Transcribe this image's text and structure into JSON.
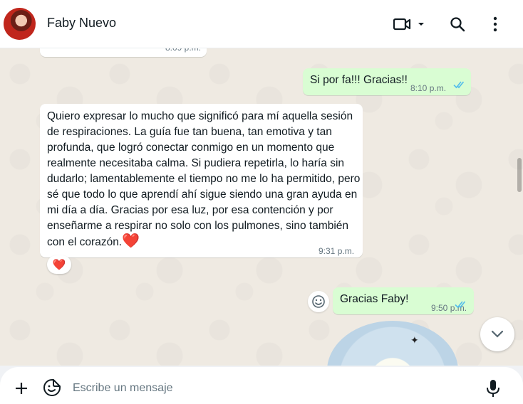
{
  "header": {
    "contact_name": "Faby Nuevo",
    "avatar_icon": "avatar-photo",
    "video_icon": "video-call-icon",
    "dropdown_icon": "chevron-down-icon",
    "search_icon": "search-icon",
    "menu_icon": "more-vertical-icon"
  },
  "messages": [
    {
      "direction": "in",
      "text": "",
      "time": "8:09 p.m."
    },
    {
      "direction": "out",
      "text": "Si por fa!!! Gracias!!",
      "time": "8:10 p.m.",
      "status": "read"
    },
    {
      "direction": "in",
      "text": "Quiero expresar lo mucho que significó para mí aquella sesión de respiraciones. La guía fue tan buena, tan emotiva y tan profunda, que logró conectar conmigo en un momento que realmente necesitaba calma. Si pudiera repetirla, lo haría sin dudarlo; lamentablemente el tiempo no me lo ha permitido, pero sé que todo lo que aprendí ahí sigue siendo una gran ayuda en mi día a día. Gracias por esa luz, por esa contención y por enseñarme a respirar no solo con los pulmones, sino también con el corazón.",
      "emoji": "❤️",
      "time": "9:31 p.m.",
      "reaction": "❤️"
    },
    {
      "direction": "out",
      "text": "Gracias Faby!",
      "time": "9:50 p.m.",
      "status": "read"
    }
  ],
  "composer": {
    "placeholder": "Escribe un mensaje",
    "plus_icon": "plus-icon",
    "sticker_icon": "sticker-icon",
    "mic_icon": "microphone-icon"
  },
  "colors": {
    "chat_bg": "#efeae2",
    "outgoing_bubble": "#d9fdd3",
    "incoming_bubble": "#ffffff",
    "read_ticks": "#53bdeb",
    "heart": "#d0132b"
  }
}
